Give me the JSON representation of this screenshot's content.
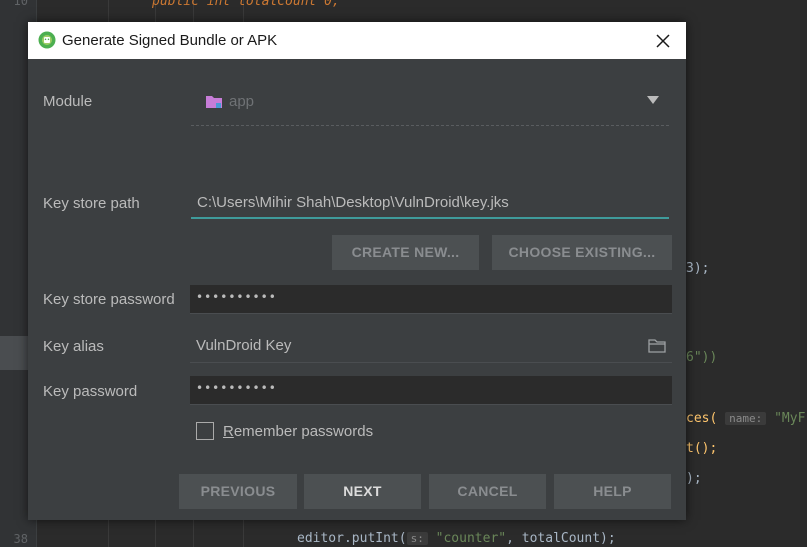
{
  "editor": {
    "line_numbers": [
      "10",
      "38"
    ],
    "code_top": "public int totalCount 0;",
    "code_r1": "3);",
    "code_r2": "6\"))",
    "code_r3_prefix": "ces(",
    "code_r3_hint": "name:",
    "code_r3_str": "\"MyF",
    "code_r4": "t();",
    "code_r5": ");",
    "code_bottom_call": "editor.putInt(",
    "code_bottom_hint": "s:",
    "code_bottom_str": "\"counter\"",
    "code_bottom_rest": ", totalCount);"
  },
  "dialog": {
    "title": "Generate Signed Bundle or APK",
    "module_label": "Module",
    "module_value": "app",
    "keystore_path_label": "Key store path",
    "keystore_path_value": "C:\\Users\\Mihir Shah\\Desktop\\VulnDroid\\key.jks",
    "create_new_button": "CREATE NEW...",
    "choose_existing_button": "CHOOSE EXISTING...",
    "keystore_password_label": "Key store password",
    "keystore_password_value": "••••••••••",
    "key_alias_label": "Key alias",
    "key_alias_value": "VulnDroid Key",
    "key_password_label": "Key password",
    "key_password_value": "••••••••••",
    "remember_label": "Remember passwords",
    "remember_checked": false,
    "previous_button": "PREVIOUS",
    "next_button": "NEXT",
    "cancel_button": "CANCEL",
    "help_button": "HELP"
  },
  "icons": {
    "title_icon": "android-studio-icon",
    "close_icon": "close-icon",
    "module_icon": "module-folder-icon",
    "dropdown_icon": "chevron-down-icon",
    "browse_icon": "folder-icon"
  },
  "colors": {
    "dialog_bg": "#3c3f41",
    "editor_bg": "#2b2b2b",
    "focus_accent": "#3f9b9b",
    "module_icon": "#c77dd8"
  }
}
